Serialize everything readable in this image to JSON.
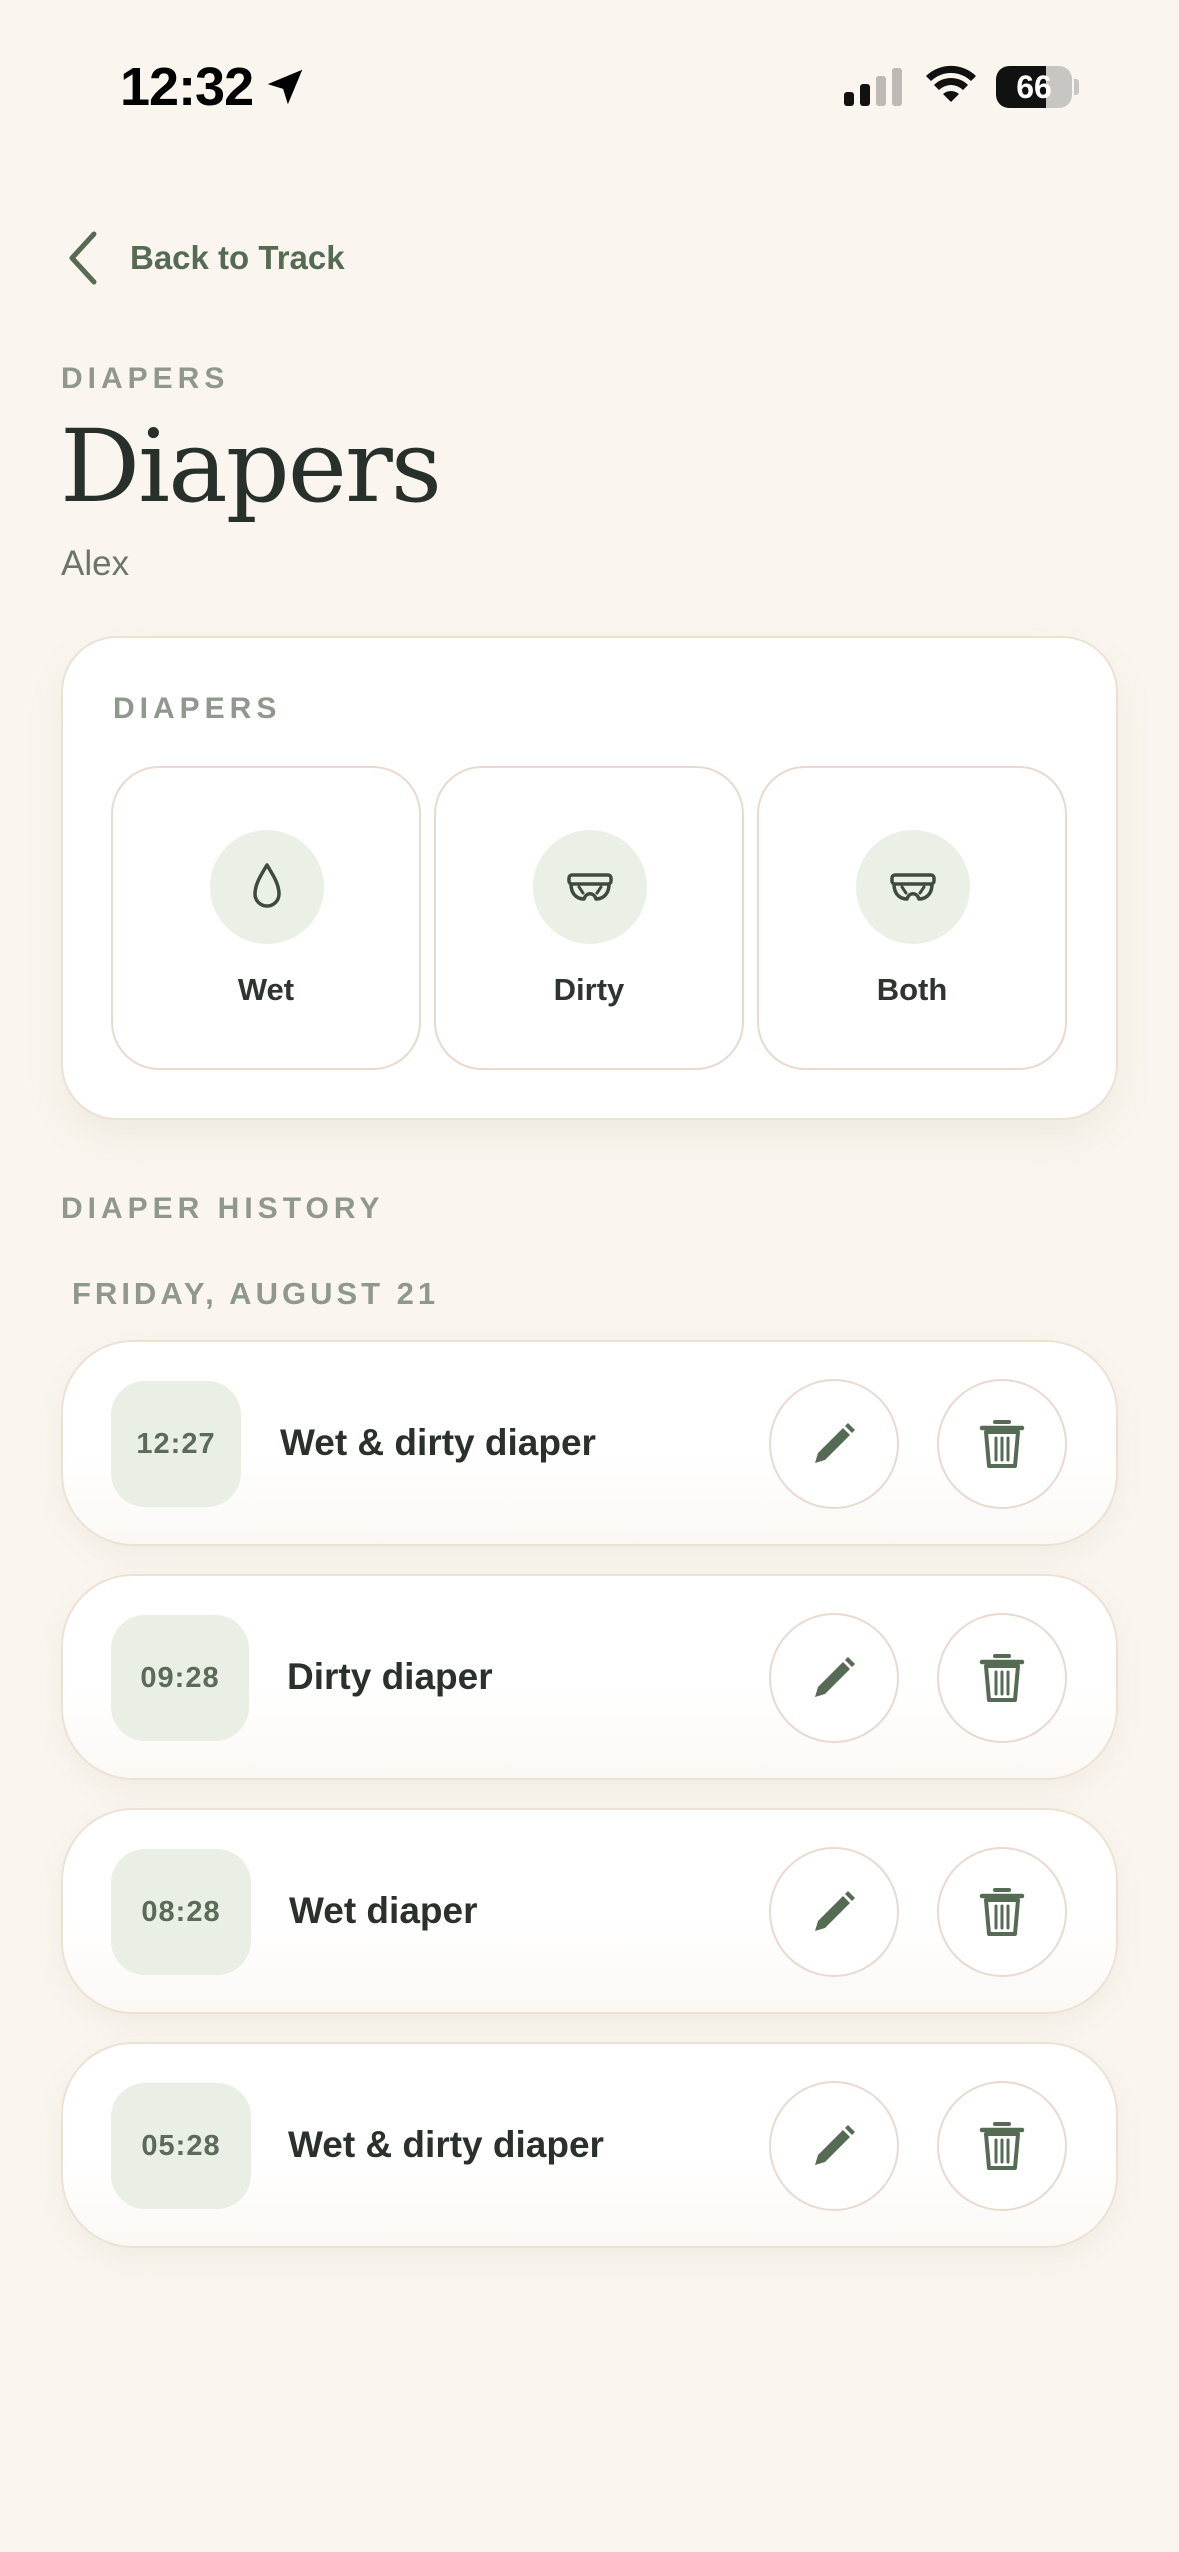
{
  "status_bar": {
    "time": "12:32",
    "battery_level": "66"
  },
  "nav": {
    "back_label": "Back to Track"
  },
  "header": {
    "eyebrow": "DIAPERS",
    "title": "Diapers",
    "subtitle": "Alex"
  },
  "quick_log": {
    "label": "DIAPERS",
    "options": [
      {
        "label": "Wet",
        "icon": "droplet-icon"
      },
      {
        "label": "Dirty",
        "icon": "diaper-icon"
      },
      {
        "label": "Both",
        "icon": "diaper-icon"
      }
    ]
  },
  "history": {
    "section_label": "DIAPER HISTORY",
    "date_label": "FRIDAY, AUGUST 21",
    "entries": [
      {
        "time": "12:27",
        "label": "Wet & dirty diaper"
      },
      {
        "time": "09:28",
        "label": "Dirty diaper"
      },
      {
        "time": "08:28",
        "label": "Wet diaper"
      },
      {
        "time": "05:28",
        "label": "Wet & dirty diaper"
      }
    ]
  },
  "colors": {
    "background": "#faf6ef",
    "accent_green": "#566b53",
    "chip_green": "#e9efe4",
    "card_border": "#ece2d4",
    "muted_label": "#8e988c"
  }
}
